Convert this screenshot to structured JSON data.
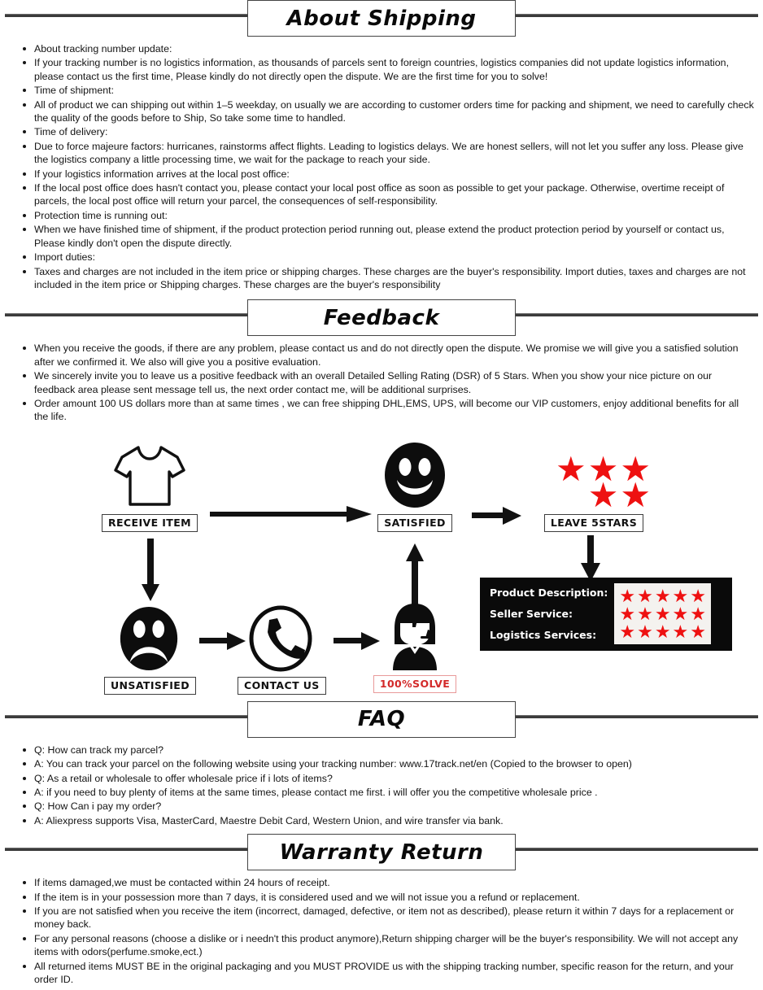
{
  "sections": [
    {
      "id": "about-shipping",
      "title": "About Shipping",
      "items": [
        "About tracking number update:",
        "If your tracking number is no logistics information, as thousands of parcels sent to foreign countries, logistics companies did not update logistics information, please contact us the first time, Please kindly do not directly open the dispute. We are the first time for you to solve!",
        "Time of shipment:",
        "All of product we can shipping out within 1–5 weekday, on usually we are according to customer orders time for packing and shipment, we need to carefully check the quality of the goods before to Ship, So take some time to handled.",
        "Time of delivery:",
        "Due to force majeure factors: hurricanes, rainstorms affect flights. Leading to logistics delays. We are honest sellers, will not let you suffer any loss. Please give the logistics company a little processing time, we wait for the package to reach your side.",
        "If your logistics information arrives at the local post office:",
        "If the local post office does hasn't contact you, please contact your local post office as soon as possible to get your package. Otherwise, overtime receipt of parcels, the local post office will return your parcel, the consequences of self-responsibility.",
        "Protection time is running out:",
        "When we have finished time of shipment, if the product protection period running out, please extend the product protection period by yourself or contact us, Please kindly don't open the dispute directly.",
        "Import duties:",
        "Taxes and charges are not included in the item price or shipping charges. These charges are the buyer's responsibility. Import duties, taxes and charges are not included in the item price or Shipping charges. These charges are the buyer's responsibility"
      ]
    },
    {
      "id": "feedback",
      "title": "Feedback",
      "items": [
        "When you receive the goods, if there are any problem, please contact us and do not directly open the dispute. We promise we will give you a satisfied solution after we confirmed it. We also will give you a positive evaluation.",
        "We sincerely invite you to leave us a positive feedback with an overall Detailed Selling Rating (DSR) of 5 Stars. When you show your nice picture on our feedback area please sent message tell us, the next order contact me, will be additional surprises.",
        "Order amount 100 US dollars more than at same times , we can free shipping DHL,EMS, UPS, will become our VIP customers, enjoy additional benefits for all the life."
      ]
    },
    {
      "id": "faq",
      "title": "FAQ",
      "items": [
        "Q: How can track my parcel?",
        "A: You can track your parcel on the following website using your tracking number: www.17track.net/en (Copied to the browser to open)",
        "Q: As a retail or wholesale to offer wholesale price if i lots of items?",
        "A: if you need to buy plenty of items at the same times, please contact me first. i will offer you the competitive wholesale price .",
        "Q: How Can i pay my order?",
        "A: Aliexpress supports Visa, MasterCard, Maestre Debit Card, Western Union, and wire transfer via bank."
      ]
    },
    {
      "id": "warranty-return",
      "title": "Warranty Return",
      "items": [
        "If items damaged,we must be contacted within 24 hours of receipt.",
        "If the item is in your possession more than 7 days, it is considered used and we will not issue you a refund or  replacement.",
        "If you are not satisfied when you receive the item (incorrect, damaged, defective, or item not as described), please return it within 7 days for a replacement or money back.",
        "For any personal reasons (choose a dislike or i needn't this product anymore),Return shipping charger will be the buyer's responsibility. We will not accept any items with odors(perfume.smoke,ect.)",
        "All returned items MUST BE in the original packaging and you MUST PROVIDE us with the shipping tracking number, specific reason for the return, and your order ID."
      ]
    }
  ],
  "flow": {
    "nodes": {
      "receive_item": {
        "caption": "RECEIVE ITEM",
        "icon": "tshirt-icon"
      },
      "satisfied": {
        "caption": "SATISFIED",
        "icon": "smiley-face-icon"
      },
      "leave_5stars": {
        "caption": "LEAVE 5STARS",
        "icon": "five-stars-icon"
      },
      "unsatisfied": {
        "caption": "UNSATISFIED",
        "icon": "sad-face-icon"
      },
      "contact_us": {
        "caption": "CONTACT US",
        "icon": "telephone-icon"
      },
      "solve": {
        "caption": "100%SOLVE",
        "icon": "support-agent-icon"
      }
    },
    "dsr_panel": {
      "rows": [
        {
          "label": "Product Description:",
          "stars": 5
        },
        {
          "label": "Seller Service:",
          "stars": 5
        },
        {
          "label": "Logistics Services:",
          "stars": 5
        }
      ],
      "star_glyph": "★",
      "star_color": "#ee1111",
      "background": "#0a0a0a",
      "label_color": "#ffffff"
    },
    "stars_top": {
      "row1": 3,
      "row2": 2,
      "color": "#ee1111"
    }
  },
  "colors": {
    "text": "#141414",
    "rule": "#3b3b3b",
    "box_border": "#444444",
    "accent_red": "#d32a2a",
    "star_red": "#ee1111"
  }
}
